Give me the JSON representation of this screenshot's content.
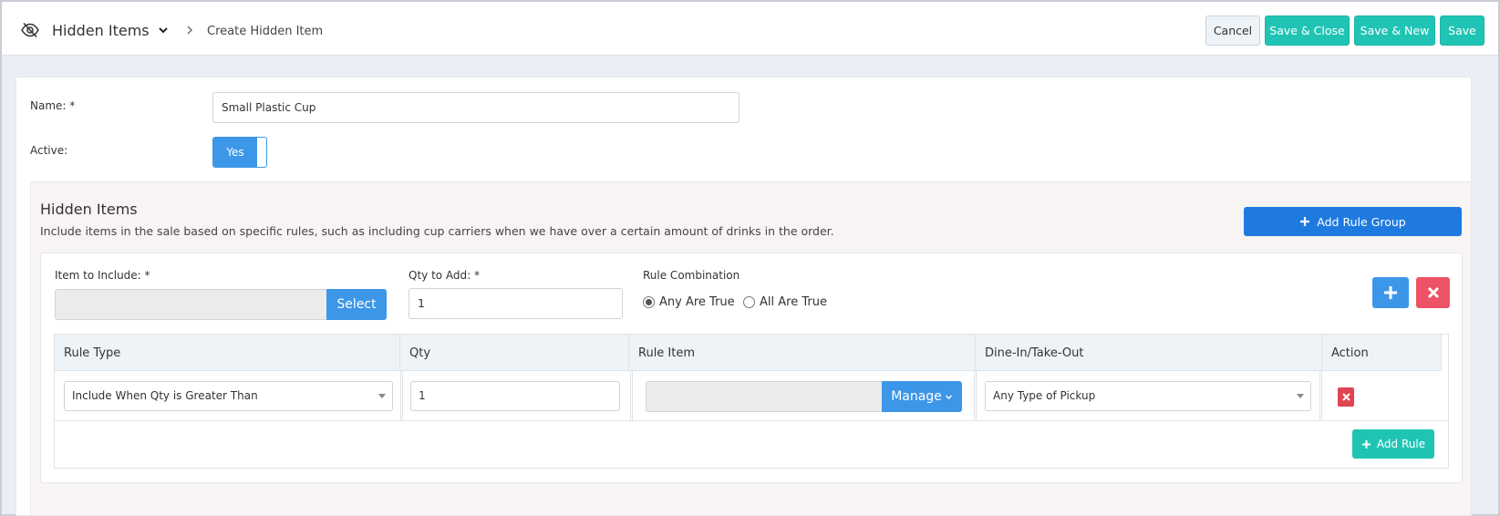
{
  "header": {
    "title": "Hidden Items",
    "breadcrumb": "Create Hidden Item",
    "icon": "eye-slash-icon"
  },
  "actions": {
    "cancel": "Cancel",
    "save_close": "Save & Close",
    "save_new": "Save & New",
    "save": "Save"
  },
  "form": {
    "name_label": "Name: *",
    "name_value": "Small Plastic Cup",
    "active_label": "Active:",
    "active_value": "Yes"
  },
  "panel": {
    "title": "Hidden Items",
    "description": "Include items in the sale based on specific rules, such as including cup carriers when we have over a certain amount of drinks in the order.",
    "add_group_label": "Add Rule Group"
  },
  "group": {
    "item_label": "Item to Include: *",
    "select_label": "Select",
    "qty_label": "Qty to Add: *",
    "qty_value": "1",
    "combination_label": "Rule Combination",
    "options": [
      "Any Are True",
      "All Are True"
    ],
    "selected_option": "Any Are True"
  },
  "table": {
    "columns": [
      "Rule Type",
      "Qty",
      "Rule Item",
      "Dine-In/Take-Out",
      "Action"
    ],
    "rows": [
      {
        "rule_type": "Include When Qty is Greater Than",
        "qty": "1",
        "rule_item": "",
        "manage_label": "Manage",
        "dine": "Any Type of Pickup"
      }
    ],
    "add_rule_label": "Add Rule"
  },
  "colors": {
    "teal": "#20c4b4",
    "blue": "#3d97e8",
    "dark_blue": "#1f7ae0",
    "red": "#ee5266"
  }
}
